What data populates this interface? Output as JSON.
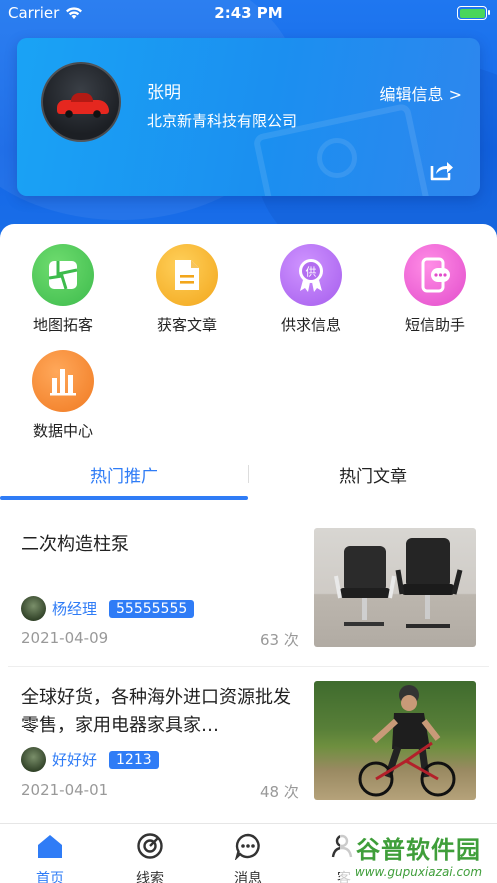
{
  "status_bar": {
    "carrier": "Carrier",
    "time": "2:43 PM",
    "battery_level": 1.0
  },
  "profile": {
    "name": "张明",
    "company": "北京新青科技有限公司",
    "edit_label": "编辑信息 >",
    "share_icon": "share-icon"
  },
  "features": [
    {
      "label": "地图拓客",
      "icon": "map-icon",
      "color": "#4cc75a"
    },
    {
      "label": "获客文章",
      "icon": "document-icon",
      "color": "#f7b325"
    },
    {
      "label": "供求信息",
      "icon": "supply-badge-icon",
      "color": "#b36ef0"
    },
    {
      "label": "短信助手",
      "icon": "sms-phone-icon",
      "color": "#f062d6"
    },
    {
      "label": "数据中心",
      "icon": "bar-chart-icon",
      "color": "#f5852d"
    }
  ],
  "tabs": {
    "active": "热门推广",
    "inactive": "热门文章"
  },
  "articles": [
    {
      "title": "二次构造柱泵",
      "author": "杨经理",
      "badge": "55555555",
      "date": "2021-04-09",
      "views": "63 次"
    },
    {
      "title": "全球好货，各种海外进口资源批发零售，家用电器家具家…",
      "author": "好好好",
      "badge": "1213",
      "date": "2021-04-01",
      "views": "48 次"
    }
  ],
  "nav": {
    "home": "首页",
    "leads": "线索",
    "messages": "消息",
    "customers": "客"
  },
  "watermark": {
    "main": "谷普软件园",
    "sub": "www.gupuxiazai.com"
  },
  "colors": {
    "primary": "#2f7cf6",
    "header_blue": "#1467e6"
  }
}
